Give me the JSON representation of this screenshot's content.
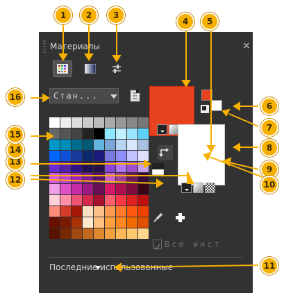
{
  "panel": {
    "title": "Материалы",
    "close_glyph": "×",
    "tools": [
      {
        "name": "swatches-grid-icon",
        "active": true
      },
      {
        "name": "gradient-icon",
        "active": false
      },
      {
        "name": "sliders-icon",
        "active": false
      }
    ],
    "library_dropdown": {
      "value": "Стан..."
    },
    "all_instances_label": "Все инст",
    "recent_label": "Последние использованные",
    "colors": {
      "accent": "#f6b000",
      "primary_swatch": "#e8411e",
      "secondary_swatch": "#ffffff",
      "panel_bg": "#323232"
    }
  },
  "swatches": [
    "#ffffff",
    "#eeeeee",
    "#dddddd",
    "#cccccc",
    "#bbbbbb",
    "#aaaaaa",
    "#999999",
    "#888888",
    "#777777",
    "#666666",
    "#555555",
    "#444444",
    "#222222",
    "#000000",
    "#8ee8ff",
    "#c2f0ff",
    "#9be4ff",
    "#5cd0f5",
    "#0097c7",
    "#008cb8",
    "#006d90",
    "#005a78",
    "#5fb4e0",
    "#79a8d6",
    "#b7d4f2",
    "#d8e9ff",
    "#a9c0e0",
    "#0066ff",
    "#0f4fd8",
    "#1b3aa0",
    "#0c2a6b",
    "#1a1a80",
    "#7a7ae0",
    "#8f8fff",
    "#c2c2ff",
    "#e0e0ff",
    "#6a2ad8",
    "#5522aa",
    "#33118a",
    "#221055",
    "#28114a",
    "#8c44d8",
    "#b075f0",
    "#a04fd0",
    "#c8a0f0",
    "#d655e8",
    "#c040d8",
    "#a026b8",
    "#801b96",
    "#5a1070",
    "#c860d0",
    "#a03c9a",
    "#6a1a5a",
    "#380a38",
    "#f0a0e8",
    "#e050c8",
    "#c82ca8",
    "#a01884",
    "#6a0e56",
    "#d81868",
    "#b01050",
    "#800d3c",
    "#3a0616",
    "#ffd0d8",
    "#ff90a8",
    "#f05578",
    "#d42a4e",
    "#a8102e",
    "#ff6070",
    "#ff3848",
    "#e02020",
    "#c01010",
    "#ff8c7a",
    "#d43a2a",
    "#a81808",
    "#ffe0c0",
    "#ffc08a",
    "#ff9a52",
    "#ff7a2a",
    "#ff5a10",
    "#f04000",
    "#6a0e00",
    "#7a1a00",
    "#a83208",
    "#ffe8d0",
    "#ffc080",
    "#ffa040",
    "#ff8820",
    "#f06a00",
    "#e05000",
    "#5a1200",
    "#7a2800",
    "#a44a10",
    "#c26820",
    "#e08830",
    "#f0a040",
    "#ffb858",
    "#ffc870",
    "#ffd890"
  ],
  "annotations": [
    "1",
    "2",
    "3",
    "4",
    "5",
    "6",
    "7",
    "8",
    "9",
    "10",
    "11",
    "12",
    "13",
    "14",
    "15",
    "16"
  ]
}
